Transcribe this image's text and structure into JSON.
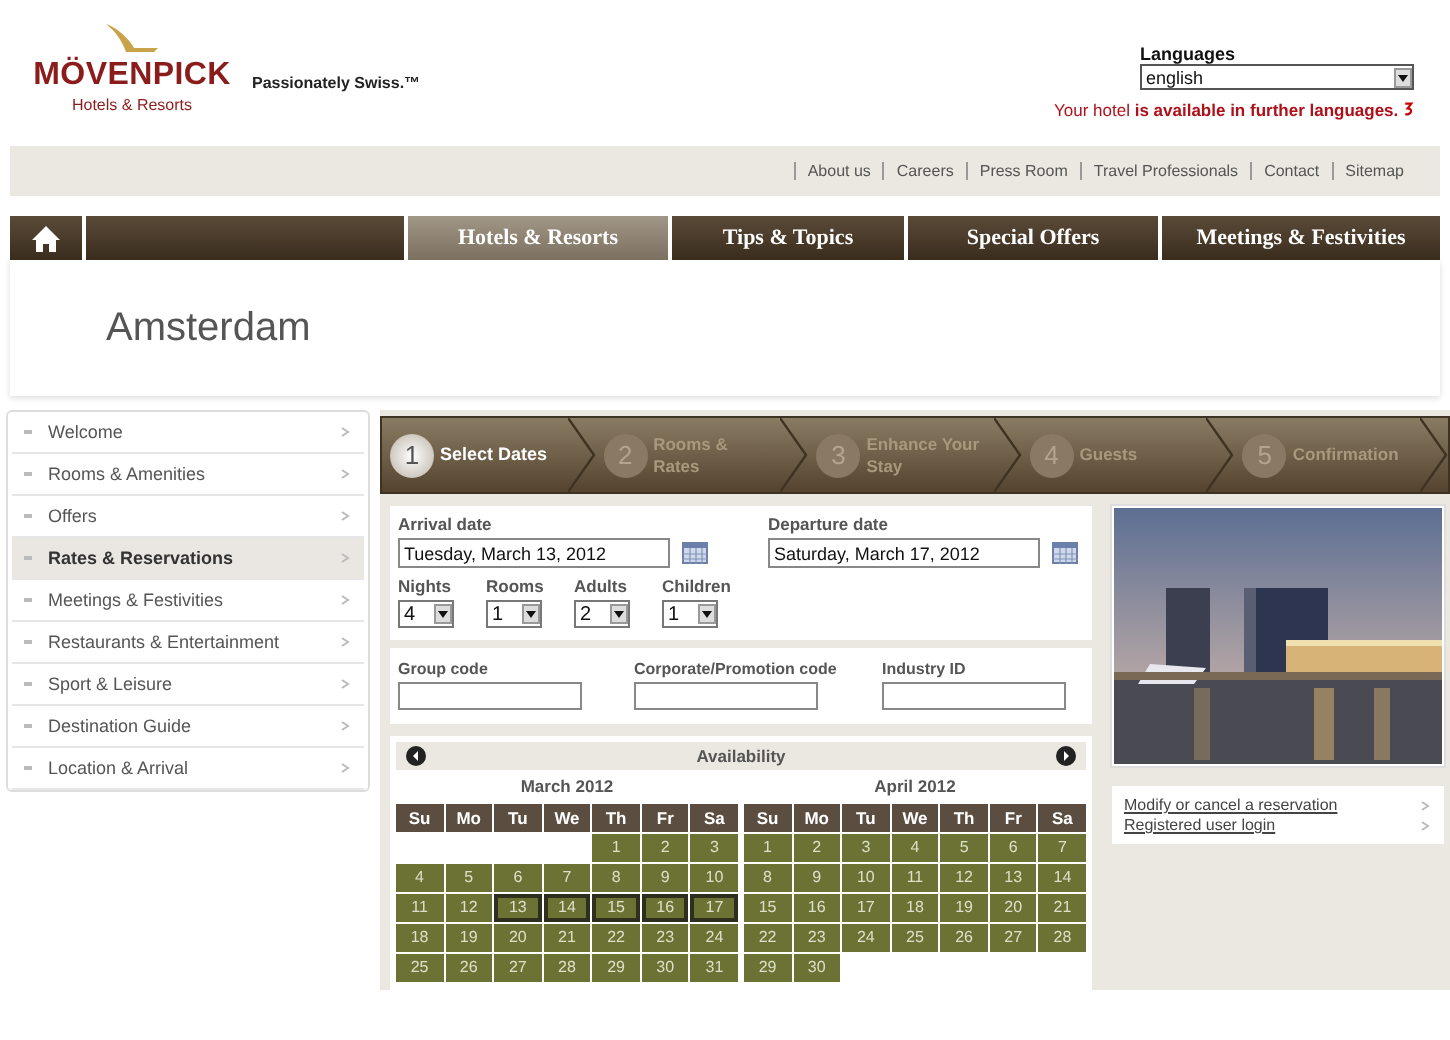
{
  "header": {
    "brand": "MÖVENPICK",
    "brand_sub": "Hotels & Resorts",
    "tagline": "Passionately Swiss.™",
    "languages_label": "Languages",
    "language": "english",
    "language_note_start": "Your hotel ",
    "language_note_bold": "is available in further languages."
  },
  "top_links": [
    "About us",
    "Careers",
    "Press Room",
    "Travel Professionals",
    "Contact",
    "Sitemap"
  ],
  "nav": [
    {
      "label": "Hotels & Resorts",
      "selected": true
    },
    {
      "label": "Tips & Topics",
      "selected": false
    },
    {
      "label": "Special Offers",
      "selected": false
    },
    {
      "label": "Meetings & Festivities",
      "selected": false
    }
  ],
  "page_title": "Amsterdam",
  "sidebar": {
    "items": [
      {
        "label": "Welcome",
        "selected": false
      },
      {
        "label": "Rooms & Amenities",
        "selected": false
      },
      {
        "label": "Offers",
        "selected": false
      },
      {
        "label": "Rates & Reservations",
        "selected": true
      },
      {
        "label": "Meetings & Festivities",
        "selected": false
      },
      {
        "label": "Restaurants & Entertainment",
        "selected": false
      },
      {
        "label": "Sport & Leisure",
        "selected": false
      },
      {
        "label": "Destination Guide",
        "selected": false
      },
      {
        "label": "Location & Arrival",
        "selected": false
      }
    ]
  },
  "steps": [
    {
      "number": "1",
      "label": "Select Dates",
      "selected": true
    },
    {
      "number": "2",
      "label": "Rooms & Rates",
      "selected": false
    },
    {
      "number": "3",
      "label": "Enhance Your Stay",
      "selected": false
    },
    {
      "number": "4",
      "label": "Guests",
      "selected": false
    },
    {
      "number": "5",
      "label": "Confirmation",
      "selected": false
    }
  ],
  "dates": [
    {
      "label": "Arrival date",
      "value": "Tuesday, March 13, 2012"
    },
    {
      "label": "Departure date",
      "value": "Saturday, March 17, 2012"
    }
  ],
  "selects": [
    {
      "label": "Nights",
      "value": "4"
    },
    {
      "label": "Rooms",
      "value": "1"
    },
    {
      "label": "Adults",
      "value": "2"
    },
    {
      "label": "Children",
      "value": "1"
    }
  ],
  "codes": [
    {
      "label": "Group code"
    },
    {
      "label": "Corporate/Promotion code"
    },
    {
      "label": "Industry ID"
    }
  ],
  "availability": {
    "title": "Availability",
    "months": [
      {
        "title": "March 2012",
        "weekdays": [
          "Su",
          "Mo",
          "Tu",
          "We",
          "Th",
          "Fr",
          "Sa"
        ],
        "weeks": [
          [
            {
              "kind": "blank"
            },
            {
              "kind": "blank"
            },
            {
              "kind": "blank"
            },
            {
              "kind": "blank"
            },
            {
              "day": "1",
              "selected": false
            },
            {
              "day": "2",
              "selected": false
            },
            {
              "day": "3",
              "selected": false
            }
          ],
          [
            {
              "day": "4",
              "selected": false
            },
            {
              "day": "5",
              "selected": false
            },
            {
              "day": "6",
              "selected": false
            },
            {
              "day": "7",
              "selected": false
            },
            {
              "day": "8",
              "selected": false
            },
            {
              "day": "9",
              "selected": false
            },
            {
              "day": "10",
              "selected": false
            }
          ],
          [
            {
              "day": "11",
              "selected": false
            },
            {
              "day": "12",
              "selected": false
            },
            {
              "day": "13",
              "selected": true
            },
            {
              "day": "14",
              "selected": true
            },
            {
              "day": "15",
              "selected": true
            },
            {
              "day": "16",
              "selected": true
            },
            {
              "day": "17",
              "selected": true
            }
          ],
          [
            {
              "day": "18",
              "selected": false
            },
            {
              "day": "19",
              "selected": false
            },
            {
              "day": "20",
              "selected": false
            },
            {
              "day": "21",
              "selected": false
            },
            {
              "day": "22",
              "selected": false
            },
            {
              "day": "23",
              "selected": false
            },
            {
              "day": "24",
              "selected": false
            }
          ],
          [
            {
              "day": "25",
              "selected": false
            },
            {
              "day": "26",
              "selected": false
            },
            {
              "day": "27",
              "selected": false
            },
            {
              "day": "28",
              "selected": false
            },
            {
              "day": "29",
              "selected": false
            },
            {
              "day": "30",
              "selected": false
            },
            {
              "day": "31",
              "selected": false
            }
          ]
        ]
      },
      {
        "title": "April 2012",
        "weekdays": [
          "Su",
          "Mo",
          "Tu",
          "We",
          "Th",
          "Fr",
          "Sa"
        ],
        "weeks": [
          [
            {
              "day": "1",
              "selected": false
            },
            {
              "day": "2",
              "selected": false
            },
            {
              "day": "3",
              "selected": false
            },
            {
              "day": "4",
              "selected": false
            },
            {
              "day": "5",
              "selected": false
            },
            {
              "day": "6",
              "selected": false
            },
            {
              "day": "7",
              "selected": false
            }
          ],
          [
            {
              "day": "8",
              "selected": false
            },
            {
              "day": "9",
              "selected": false
            },
            {
              "day": "10",
              "selected": false
            },
            {
              "day": "11",
              "selected": false
            },
            {
              "day": "12",
              "selected": false
            },
            {
              "day": "13",
              "selected": false
            },
            {
              "day": "14",
              "selected": false
            }
          ],
          [
            {
              "day": "15",
              "selected": false
            },
            {
              "day": "16",
              "selected": false
            },
            {
              "day": "17",
              "selected": false
            },
            {
              "day": "18",
              "selected": false
            },
            {
              "day": "19",
              "selected": false
            },
            {
              "day": "20",
              "selected": false
            },
            {
              "day": "21",
              "selected": false
            }
          ],
          [
            {
              "day": "22",
              "selected": false
            },
            {
              "day": "23",
              "selected": false
            },
            {
              "day": "24",
              "selected": false
            },
            {
              "day": "25",
              "selected": false
            },
            {
              "day": "26",
              "selected": false
            },
            {
              "day": "27",
              "selected": false
            },
            {
              "day": "28",
              "selected": false
            }
          ],
          [
            {
              "day": "29",
              "selected": false
            },
            {
              "day": "30",
              "selected": false
            },
            {
              "kind": "blank"
            },
            {
              "kind": "blank"
            },
            {
              "kind": "blank"
            },
            {
              "kind": "blank"
            },
            {
              "kind": "blank"
            }
          ]
        ]
      }
    ]
  },
  "side_links": [
    "Modify or cancel a reservation",
    "Registered user login"
  ]
}
